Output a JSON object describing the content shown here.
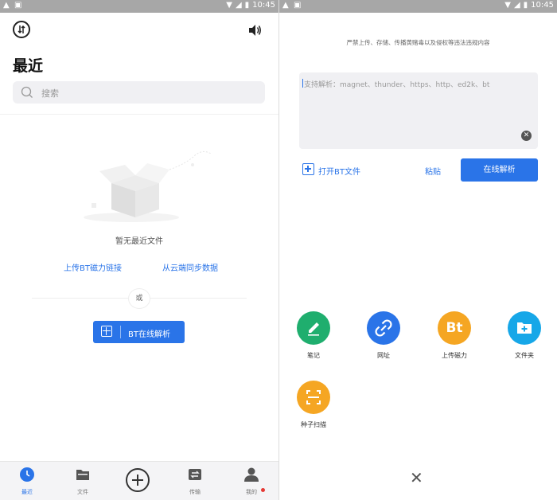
{
  "status_bar": {
    "time": "10:45"
  },
  "left": {
    "title": "最近",
    "search_placeholder": "搜索",
    "empty_text": "暂无最近文件",
    "link_upload_bt": "上传BT磁力链接",
    "link_cloud_sync": "从云端同步数据",
    "or_label": "或",
    "bt_button": "BT在线解析",
    "tabs": [
      {
        "label": "最近",
        "icon": "clock-icon"
      },
      {
        "label": "文件",
        "icon": "folder-icon"
      },
      {
        "label": "",
        "icon": "plus-icon"
      },
      {
        "label": "传输",
        "icon": "transfer-icon"
      },
      {
        "label": "我的",
        "icon": "person-icon"
      }
    ]
  },
  "right": {
    "notice": "严禁上传、存储、传播黄赌毒以及侵权等违法违规内容",
    "input_placeholder": "支持解析：magnet、thunder、https、http、ed2k、bt",
    "open_bt": "打开BT文件",
    "paste": "粘贴",
    "parse_button": "在线解析",
    "actions": [
      {
        "label": "笔记",
        "icon": "pencil-icon",
        "color": "#1fae6e"
      },
      {
        "label": "网址",
        "icon": "link-icon",
        "color": "#2a74e8"
      },
      {
        "label": "上传磁力",
        "icon": "bt-icon",
        "color": "#f5a623",
        "glyph": "Bt"
      },
      {
        "label": "文件夹",
        "icon": "folder-plus-icon",
        "color": "#16a7e8"
      },
      {
        "label": "种子扫描",
        "icon": "scan-icon",
        "color": "#f5a623"
      }
    ]
  },
  "colors": {
    "accent": "#2a74e8",
    "red_dot": "#e53935"
  }
}
